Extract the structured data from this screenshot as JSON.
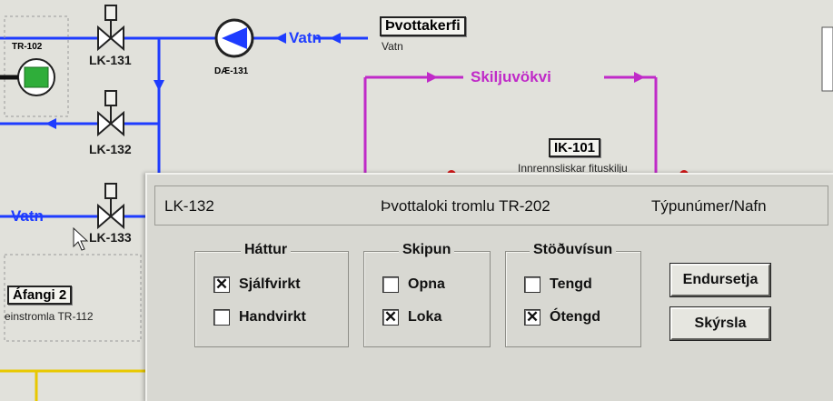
{
  "diagram": {
    "valves": [
      "LK-131",
      "LK-132",
      "LK-133"
    ],
    "tank_tag": "TR-102",
    "pump_tag": "DÆ-131",
    "flow_water_top": "Vatn",
    "flow_water_left": "Vatn",
    "system_tag": "Þvottakerfi",
    "system_sub": "Vatn",
    "separator_flow": "Skiljuvökvi",
    "ik_tag": "IK-101",
    "ik_desc": "Innrennsliskar fituskilju",
    "stage_tag": "Áfangi 2",
    "stage_desc": "einstromla TR-112"
  },
  "dialog": {
    "tag": "LK-132",
    "description": "Þvottaloki tromlu TR-202",
    "type_label": "Týpunúmer/Nafn",
    "groups": {
      "hattur": {
        "title": "Háttur",
        "options": [
          {
            "label": "Sjálfvirkt",
            "checked": true
          },
          {
            "label": "Handvirkt",
            "checked": false
          }
        ]
      },
      "skipun": {
        "title": "Skipun",
        "options": [
          {
            "label": "Opna",
            "checked": false
          },
          {
            "label": "Loka",
            "checked": true
          }
        ]
      },
      "stodu": {
        "title": "Stöðuvísun",
        "options": [
          {
            "label": "Tengd",
            "checked": false
          },
          {
            "label": "Ótengd",
            "checked": true
          }
        ]
      }
    },
    "buttons": {
      "reset": "Endursetja",
      "report": "Skýrsla"
    }
  },
  "colors": {
    "pipe_blue": "#1e3cff",
    "pipe_magenta": "#c02ac8",
    "alarm_red": "#d21818",
    "tank_green": "#2fae3a",
    "yellow_line": "#e8c800"
  }
}
